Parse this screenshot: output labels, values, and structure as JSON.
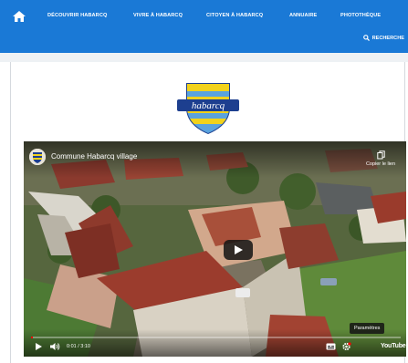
{
  "nav": {
    "home_icon": "home-icon",
    "items": [
      {
        "label": "DÉCOUVRIR HABARCQ"
      },
      {
        "label": "VIVRE À HABARCQ"
      },
      {
        "label": "CITOYEN À HABARCQ"
      },
      {
        "label": "ANNUAIRE"
      },
      {
        "label": "PHOTOTHÈQUE"
      }
    ],
    "search_label": "RECHERCHE",
    "color": "#1a79d6"
  },
  "logo": {
    "text": "habarcq"
  },
  "video": {
    "title": "Commune Habarcq village",
    "copy_link": "Copier le lien",
    "settings_tooltip": "Paramètres",
    "time": "0:01 / 3:10",
    "progress": 0.005,
    "brand": "YouTube"
  }
}
